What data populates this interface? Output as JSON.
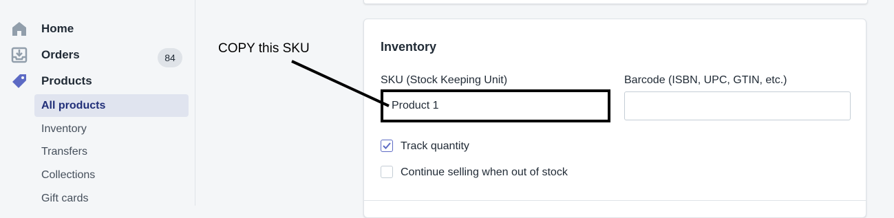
{
  "sidebar": {
    "home": "Home",
    "orders": "Orders",
    "orders_badge": "84",
    "products": "Products",
    "sub_items": [
      "All products",
      "Inventory",
      "Transfers",
      "Collections",
      "Gift cards"
    ]
  },
  "inventory_card": {
    "title": "Inventory",
    "sku_label": "SKU (Stock Keeping Unit)",
    "sku_value": "Product 1",
    "barcode_label": "Barcode (ISBN, UPC, GTIN, etc.)",
    "barcode_value": "",
    "track_quantity_label": "Track quantity",
    "track_quantity_checked": true,
    "continue_selling_label": "Continue selling when out of stock",
    "continue_selling_checked": false
  },
  "annotation": {
    "text": "COPY this SKU"
  },
  "colors": {
    "accent": "#5c6ac4",
    "active_bg": "#e0e4ef",
    "active_text": "#202e78",
    "icon": "#919eab"
  }
}
